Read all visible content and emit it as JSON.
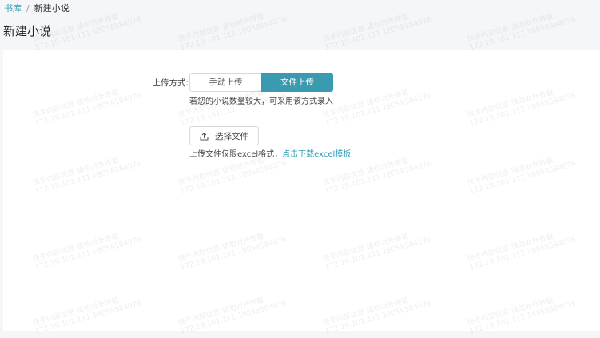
{
  "breadcrumb": {
    "parent": "书库",
    "separator": "/",
    "current": "新建小说"
  },
  "page_title": "新建小说",
  "form": {
    "upload_label": "上传方式:",
    "options": [
      {
        "label": "手动上传",
        "active": false
      },
      {
        "label": "文件上传",
        "active": true
      }
    ],
    "hint": "若您的小说数量较大，可采用该方式录入",
    "choose_file_label": "选择文件",
    "file_hint_prefix": "上传文件仅限excel格式，",
    "file_hint_link": "点击下载excel模板"
  },
  "watermark": {
    "line1": "快手内部信息 请勿对外转载",
    "line2": "172.19.101.111 18058584076"
  },
  "colors": {
    "accent": "#2f9db4",
    "active_toggle_bg": "#3a9bb0"
  }
}
